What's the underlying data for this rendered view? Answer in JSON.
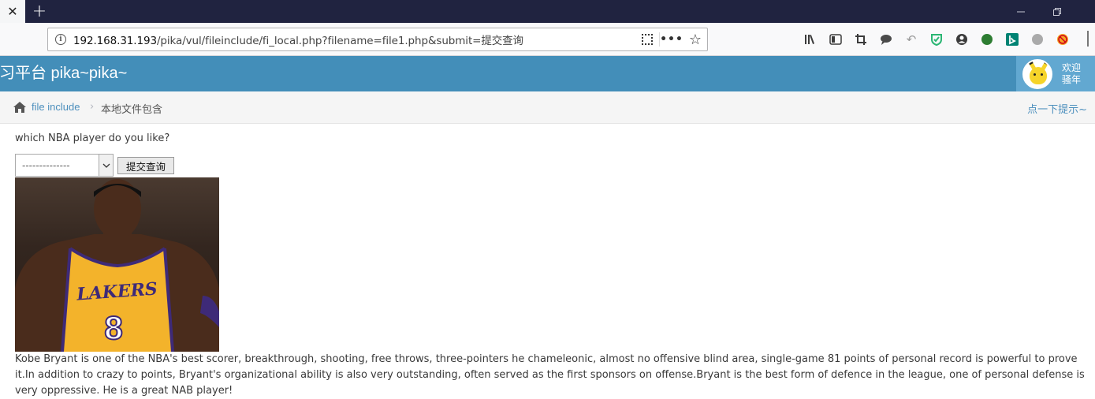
{
  "browser": {
    "tab_close": "✕",
    "new_tab": "+",
    "url_host": "192.168.31.193",
    "url_path": "/pika/vul/fileinclude/fi_local.php?filename=file1.php&submit=提交查询",
    "window_controls": [
      "minimize-icon",
      "restore-icon"
    ],
    "toolbar_icons": [
      "library-icon",
      "sidebar-icon",
      "screenshot-icon",
      "chat-icon",
      "back-icon",
      "shield-icon",
      "account-icon",
      "extension-icon",
      "bing-icon",
      "extension-gray-icon",
      "block-icon"
    ]
  },
  "header": {
    "brand": "习平台 pika~pika~",
    "welcome_line1": "欢迎",
    "welcome_line2": "骚年"
  },
  "breadcrumb": {
    "link": "file include",
    "current": "本地文件包含",
    "hint": "点一下提示~"
  },
  "form": {
    "question": "which NBA player do you like?",
    "select_value": "--------------",
    "submit_label": "提交查询"
  },
  "content": {
    "description": "Kobe Bryant is one of the NBA's best scorer, breakthrough, shooting, free throws, three-pointers he chameleonic, almost no offensive blind area, single-game 81 points of personal record is powerful to prove it.In addition to crazy to points, Bryant's organizational ability is also very outstanding, often served as the first sponsors on offense.Bryant is the best form of defence in the league, one of personal defense is very oppressive. He is a great NAB player!",
    "jersey_text": "LAKERS",
    "jersey_number": "8"
  },
  "colors": {
    "header_bg": "#438eb9",
    "userbox_bg": "#62a8d1",
    "link": "#4c8fbd",
    "jersey_gold": "#f3b32b",
    "jersey_purple": "#3e2a78"
  }
}
